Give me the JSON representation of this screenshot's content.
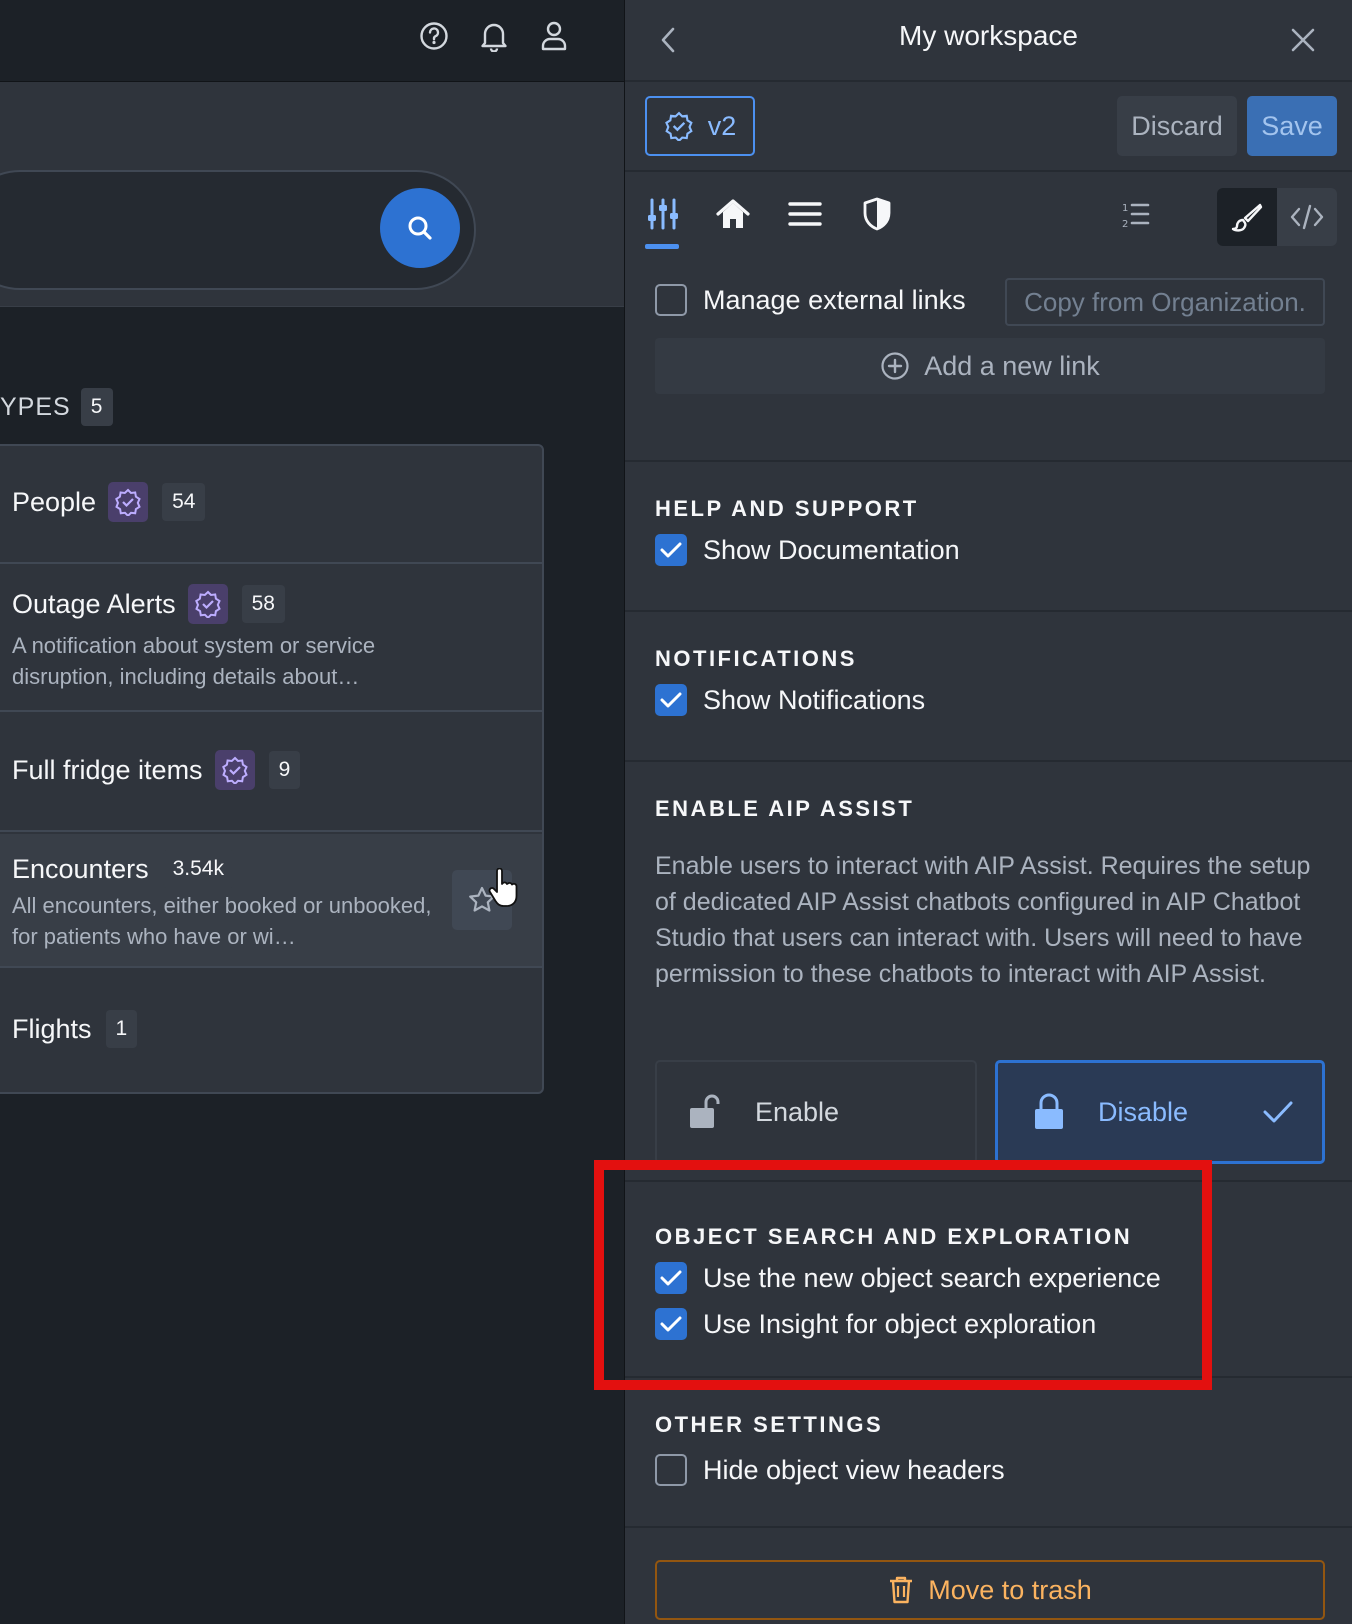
{
  "left": {
    "types_label": "YPES",
    "types_count": "5",
    "object_types": [
      {
        "name": "People",
        "count": "54",
        "description": ""
      },
      {
        "name": "Outage Alerts",
        "count": "58",
        "description": "A notification about system or service disruption, including details about…"
      },
      {
        "name": "Full fridge items",
        "count": "9",
        "description": ""
      },
      {
        "name": "Encounters",
        "count": "3.54k",
        "description": "All encounters, either booked or unbooked, for patients who have or wi…"
      },
      {
        "name": "Flights",
        "count": "1",
        "description": ""
      }
    ]
  },
  "panel": {
    "title": "My workspace",
    "version": "v2",
    "discard_label": "Discard",
    "save_label": "Save",
    "links": {
      "manage_label": "Manage external links",
      "copy_label": "Copy from Organization.",
      "add_label": "Add a new link"
    },
    "help": {
      "title": "HELP AND SUPPORT",
      "show_docs": "Show Documentation"
    },
    "notifications": {
      "title": "NOTIFICATIONS",
      "show_notifications": "Show Notifications"
    },
    "aip": {
      "title": "ENABLE AIP ASSIST",
      "description": "Enable users to interact with AIP Assist. Requires the setup of dedicated AIP Assist chatbots configured in AIP Chatbot Studio that users can interact with. Users will need to have permission to these chatbots to interact with AIP Assist.",
      "enable_label": "Enable",
      "disable_label": "Disable",
      "selected": "Disable"
    },
    "object_search": {
      "title": "OBJECT SEARCH AND EXPLORATION",
      "new_search": "Use the new object search experience",
      "insight": "Use Insight for object exploration"
    },
    "other": {
      "title": "OTHER SETTINGS",
      "hide_headers": "Hide object view headers"
    },
    "trash_label": "Move to trash"
  },
  "colors": {
    "accent": "#2d72d2",
    "highlight": "#e3100f",
    "danger_text": "#fbb360"
  }
}
